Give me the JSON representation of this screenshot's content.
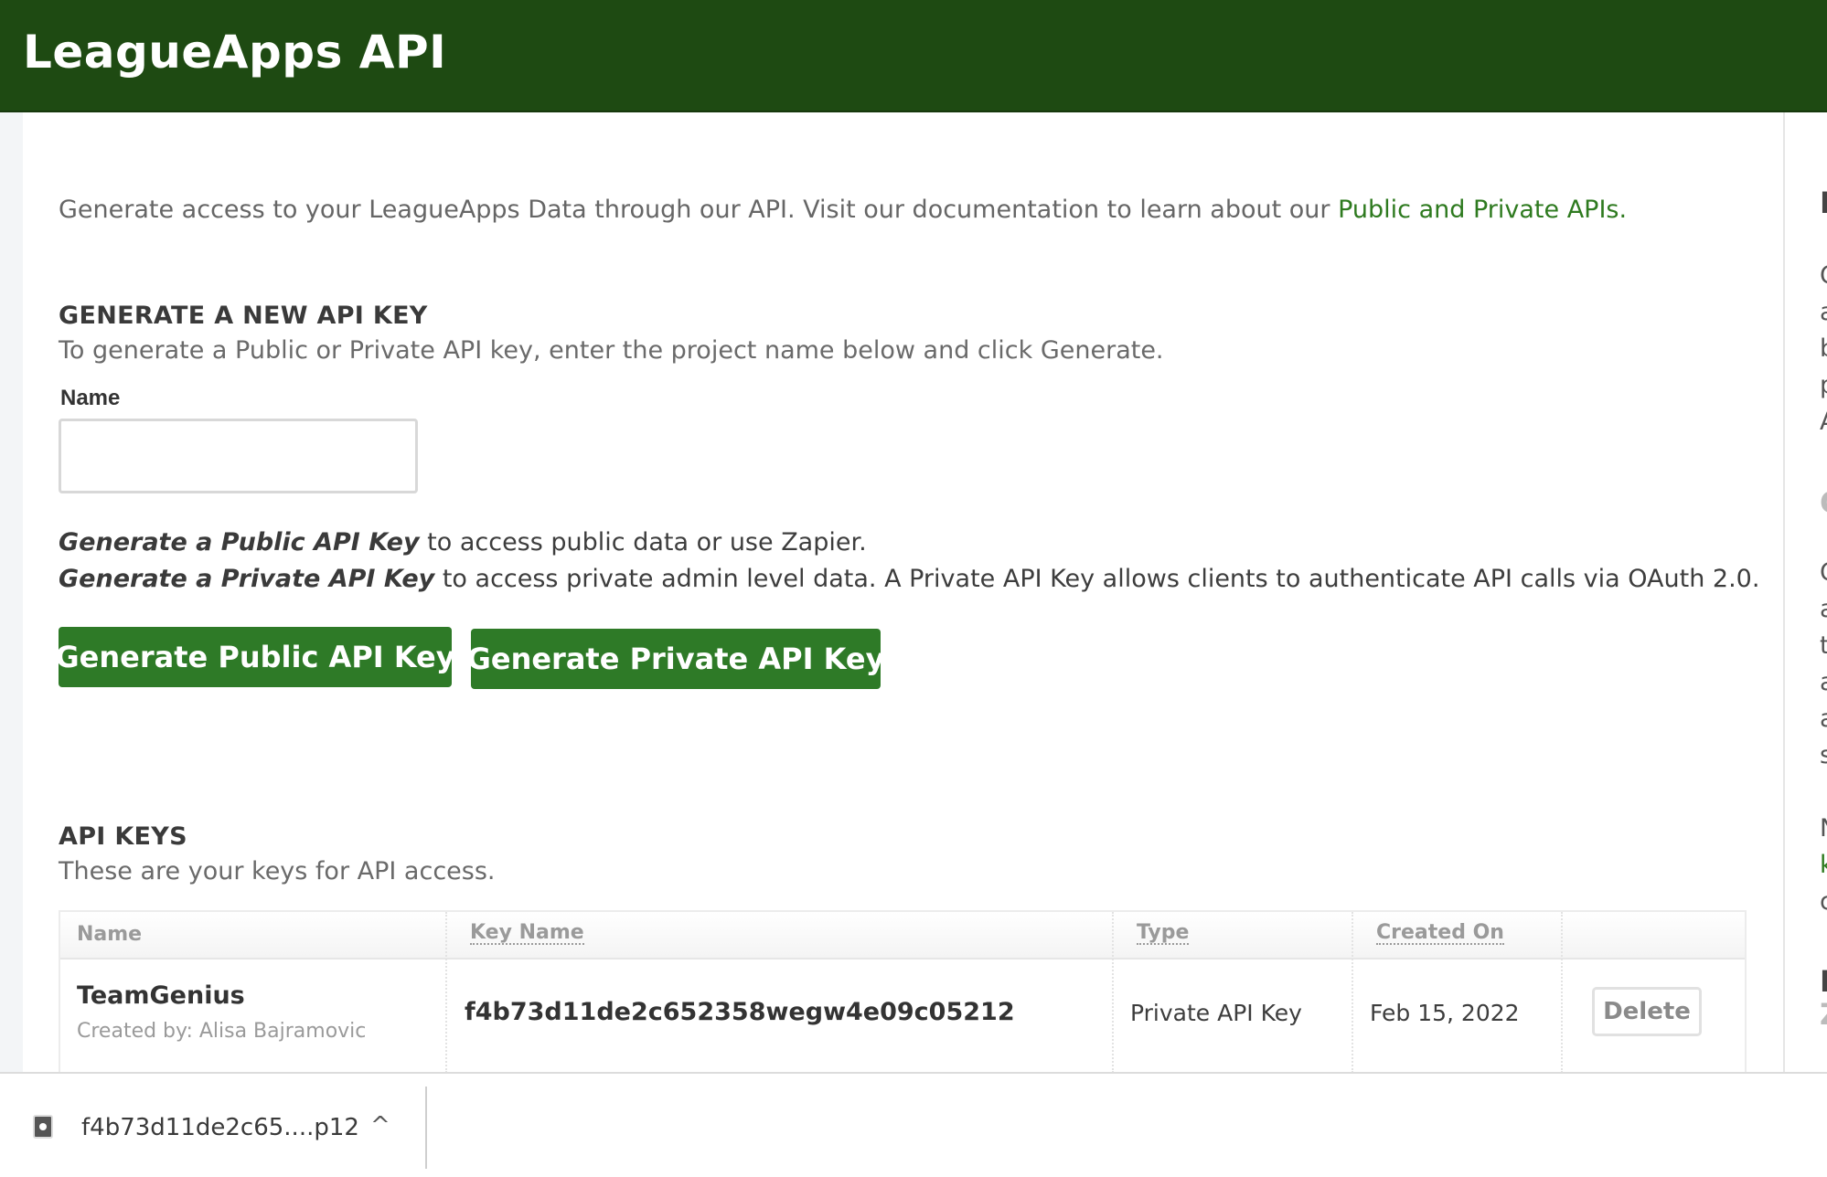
{
  "header": {
    "title": "LeagueApps API"
  },
  "intro": {
    "text": "Generate access to your LeagueApps Data through our API. Visit our documentation to learn about our ",
    "link_label": "Public and Private APIs."
  },
  "generate": {
    "title": "GENERATE A NEW API KEY",
    "subtitle": "To generate a Public or Private API key, enter the project name below and click Generate.",
    "name_label": "Name",
    "name_value": "",
    "public_desc_em": "Generate a Public API Key",
    "public_desc_rest": " to access public data or use Zapier.",
    "private_desc_em": "Generate a Private API Key",
    "private_desc_rest": " to access private admin level data. A Private API Key allows clients to authenticate API calls via OAuth 2.0.",
    "public_button": "Generate Public API Key",
    "private_button": "Generate Private API Key"
  },
  "keys": {
    "title": "API KEYS",
    "subtitle": "These are your keys for API access.",
    "columns": [
      "Name",
      "Key Name",
      "Type",
      "Created On",
      ""
    ],
    "rows": [
      {
        "name": "TeamGenius",
        "created_by": "Created by: Alisa Bajramovic",
        "key_name": "f4b73d11de2c652358wegw4e09c05212",
        "type": "Private API Key",
        "created_on": "Feb 15, 2022",
        "action": "Delete"
      }
    ]
  },
  "right_panel": {
    "glyphs": [
      "I",
      "C",
      "a",
      "b",
      "p",
      "A",
      "C",
      "C",
      "a",
      "t",
      "a",
      "a",
      "s",
      "N",
      "k",
      "c",
      "I",
      "Z"
    ]
  },
  "download_bar": {
    "file_name": "f4b73d11de2c65....p12",
    "chevron": "^"
  },
  "colors": {
    "header_bg": "#1e4a12",
    "accent_green": "#2e7a27",
    "link_green": "#2e7a1f"
  }
}
